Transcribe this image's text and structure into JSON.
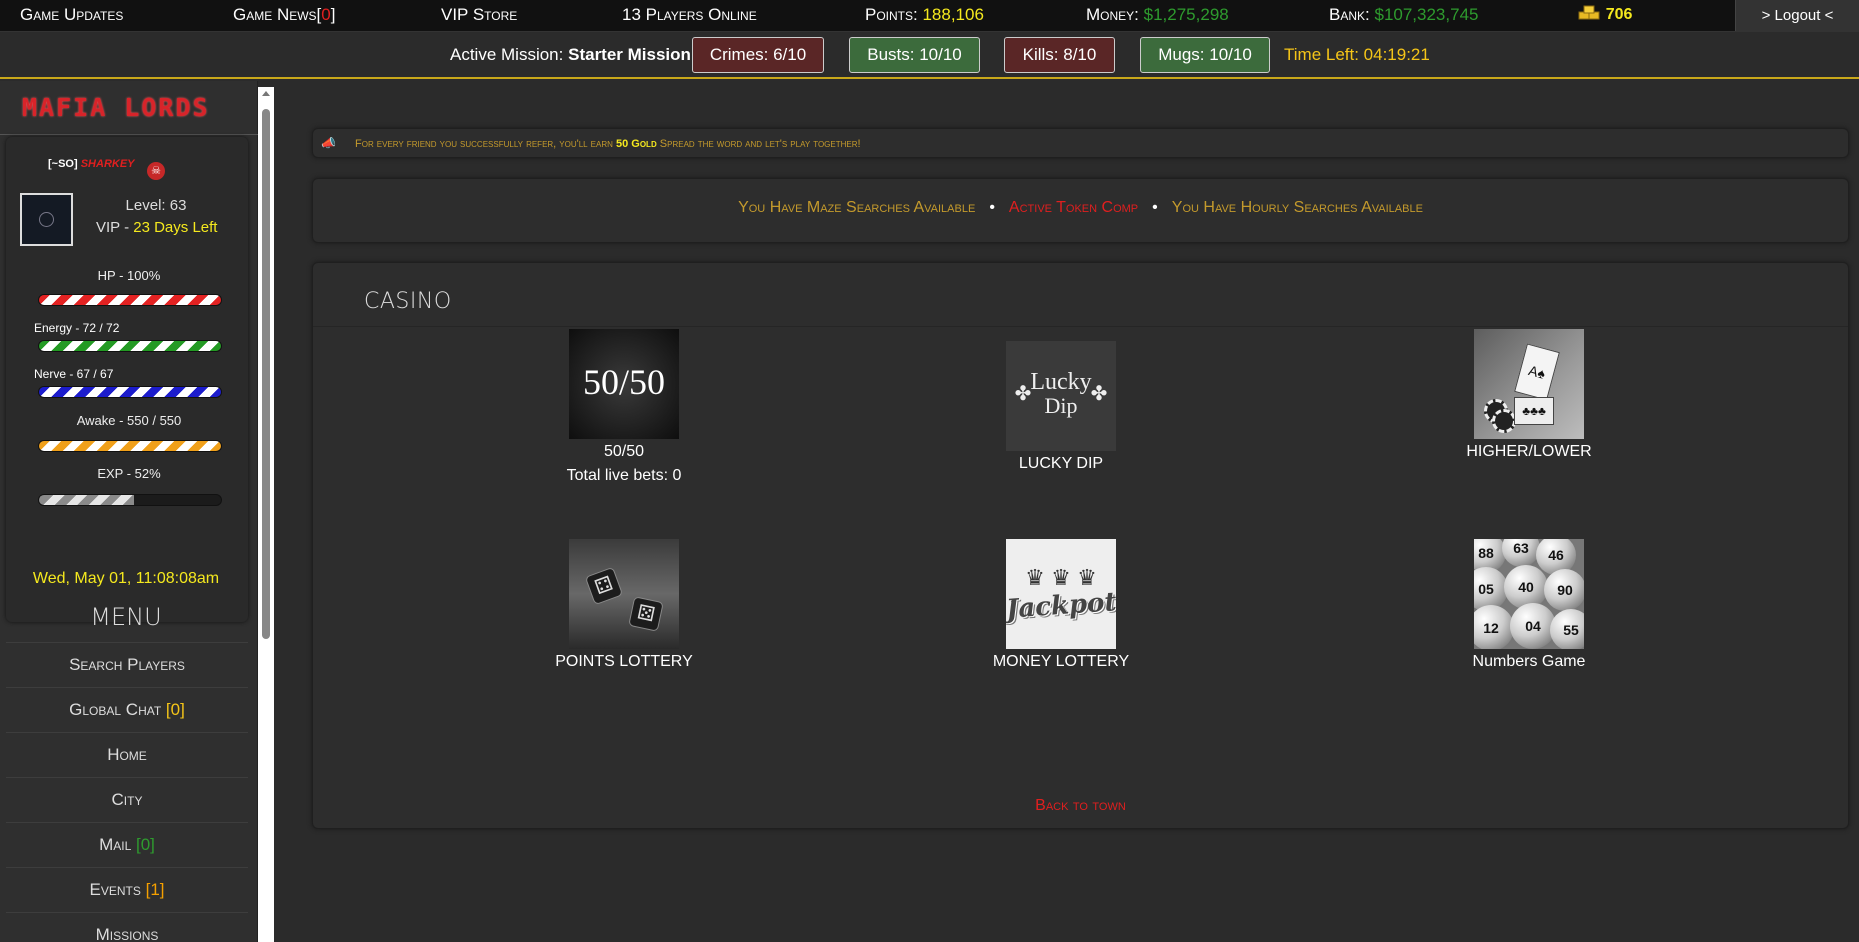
{
  "topbar": {
    "game_updates": "Game Updates",
    "game_news_label": "Game News[",
    "game_news_count": "0",
    "game_news_close": "]",
    "vip_store": "VIP Store",
    "players_online": "13 Players Online",
    "points_label": "Points:",
    "points_value": "188,106",
    "money_label": "Money:",
    "money_value": "$1,275,298",
    "bank_label": "Bank:",
    "bank_value": "$107,323,745",
    "gold_value": "706",
    "logout": "> Logout <"
  },
  "mission": {
    "label": "Active Mission:",
    "name": "Starter Mission",
    "crimes": "Crimes: 6/10",
    "busts": "Busts: 10/10",
    "kills": "Kills: 8/10",
    "mugs": "Mugs: 10/10",
    "time_left": "Time Left: 04:19:21"
  },
  "sidebar": {
    "logo": "MAFIA LORDS",
    "gang_tag": "[~SO]",
    "username": "SHARKEY",
    "level": "Level: 63",
    "vip_label": "VIP -",
    "vip_days": "23 Days Left",
    "stats": {
      "hp": "HP - 100%",
      "energy": "Energy - 72 / 72",
      "nerve": "Nerve - 67 / 67",
      "awake": "Awake - 550 / 550",
      "exp": "EXP - 52%"
    },
    "stat_fill": {
      "hp": 1.0,
      "energy": 1.0,
      "nerve": 1.0,
      "awake": 1.0,
      "exp": 0.52
    },
    "clock": "Wed, May 01, 11:08:08am",
    "menu_title": "MENU",
    "menu": {
      "search_players": "Search Players",
      "global_chat": "Global Chat",
      "global_chat_count": "[0]",
      "home": "Home",
      "city": "City",
      "mail": "Mail",
      "mail_count": "[0]",
      "events": "Events",
      "events_count": "[1]",
      "missions": "Missions"
    }
  },
  "notice": {
    "text_before": "For every friend you successfully refer, you'll earn",
    "gold": "50 Gold",
    "text_after": "Spread the word and let's play together!"
  },
  "alerts": {
    "maze": "You Have Maze Searches Available",
    "token": "Active Token Comp",
    "hourly": "You Have Hourly Searches Available",
    "separator": "•"
  },
  "casino": {
    "title": "CASINO",
    "games": {
      "fifty": {
        "image_text": "50/50",
        "label": "50/50",
        "sub": "Total live bets: 0"
      },
      "lucky": {
        "image_line1": "Lucky",
        "image_line2": "Dip",
        "label": "LUCKY DIP"
      },
      "higher": {
        "label": "HIGHER/LOWER"
      },
      "points_lottery": {
        "label": "POINTS LOTTERY"
      },
      "money_lottery": {
        "image_text": "Jackpot",
        "label": "MONEY LOTTERY"
      },
      "numbers": {
        "label": "Numbers Game"
      }
    },
    "back": "Back to town"
  },
  "colors": {
    "accent_gold": "#c9a81a",
    "money_green": "#2e9b2e",
    "highlight_yellow": "#f5e91e",
    "alert_red": "#e01f1f"
  }
}
